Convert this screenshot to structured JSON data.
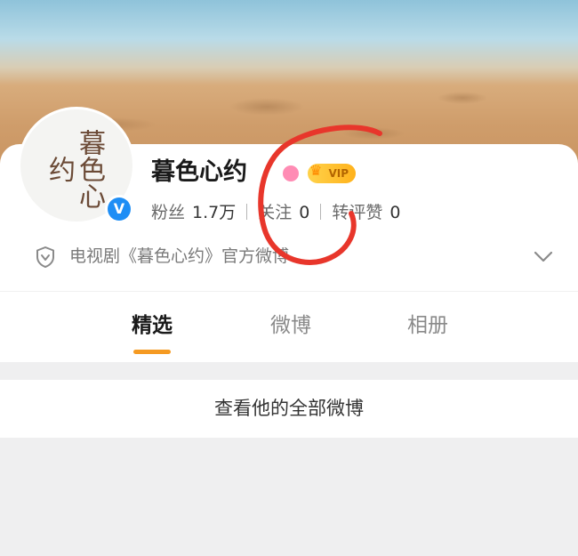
{
  "profile": {
    "name": "暮色心约",
    "avatar_text": "暮色心约",
    "vip_label": "VIP",
    "stats": [
      {
        "label": "粉丝",
        "value": "1.7万"
      },
      {
        "label": "关注",
        "value": "0"
      },
      {
        "label": "转评赞",
        "value": "0"
      }
    ],
    "description": "电视剧《暮色心约》官方微博"
  },
  "tabs": [
    {
      "label": "精选",
      "active": true
    },
    {
      "label": "微博",
      "active": false
    },
    {
      "label": "相册",
      "active": false
    }
  ],
  "all_posts_label": "查看他的全部微博",
  "colors": {
    "accent": "#f59a22",
    "verified": "#1e8ef5",
    "annotation": "#e8362b"
  },
  "icons": [
    "verified-icon",
    "vip-crown-icon",
    "shield-icon",
    "chevron-down-icon"
  ]
}
